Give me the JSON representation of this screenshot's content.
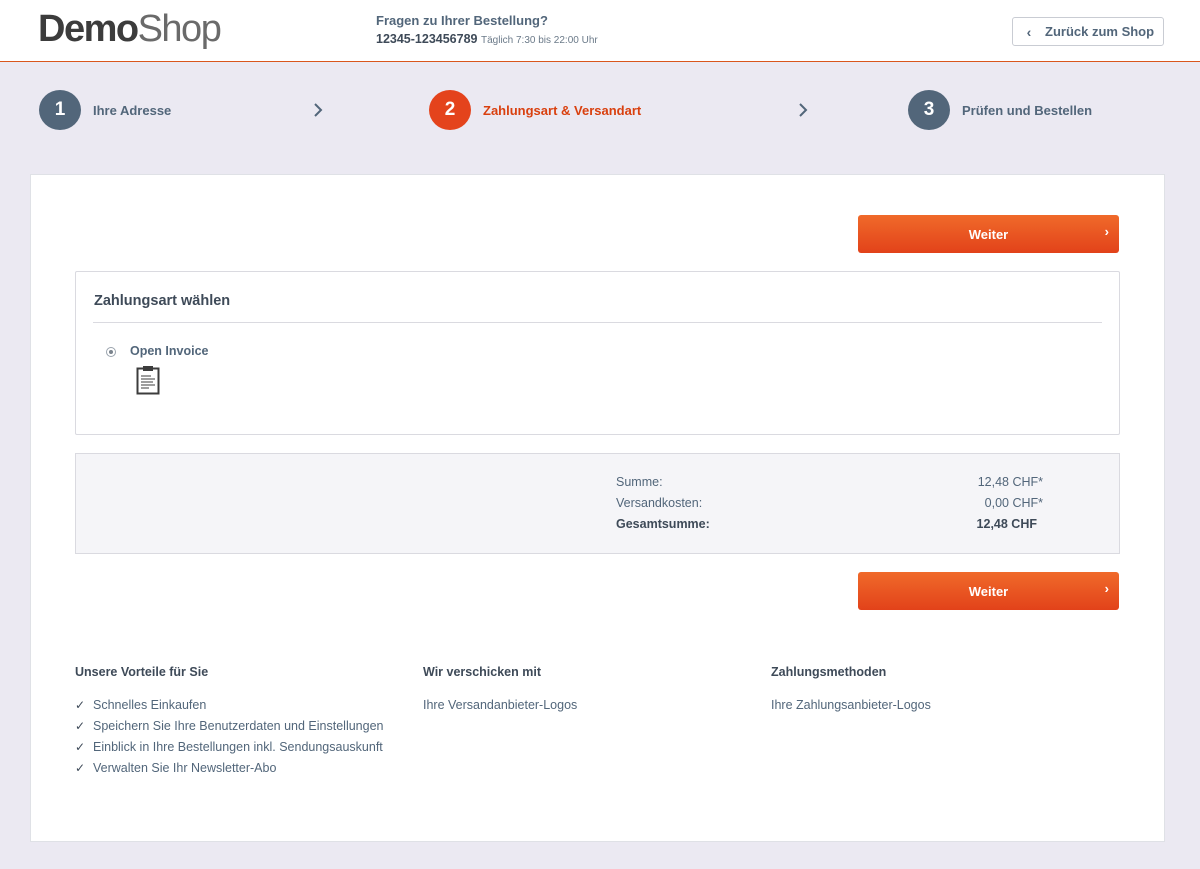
{
  "header": {
    "logo_part1": "Demo",
    "logo_part2": "Shop",
    "hotline_question": "Fragen zu Ihrer Bestellung?",
    "hotline_number": "12345-123456789",
    "hotline_hours": "Täglich 7:30 bis 22:00 Uhr",
    "back_label": "Zurück zum Shop"
  },
  "steps": [
    {
      "number": "1",
      "label": "Ihre Adresse",
      "state": "done"
    },
    {
      "number": "2",
      "label": "Zahlungsart & Versandart",
      "state": "active"
    },
    {
      "number": "3",
      "label": "Prüfen und Bestellen",
      "state": "upcoming"
    }
  ],
  "actions": {
    "next_label": "Weiter"
  },
  "payment": {
    "title": "Zahlungsart wählen",
    "methods": [
      {
        "name": "Open Invoice",
        "selected": true,
        "icon": "clipboard-icon"
      }
    ]
  },
  "summary": {
    "rows": [
      {
        "label": "Summe:",
        "value": "12,48 CHF*"
      },
      {
        "label": "Versandkosten:",
        "value": "0,00 CHF*"
      },
      {
        "label": "Gesamtsumme:",
        "value": "12,48 CHF"
      }
    ]
  },
  "footer": {
    "benefits_title": "Unsere Vorteile für Sie",
    "benefits": [
      "Schnelles Einkaufen",
      "Speichern Sie Ihre Benutzerdaten und Einstellungen",
      "Einblick in Ihre Bestellungen inkl. Sendungsauskunft",
      "Verwalten Sie Ihr Newsletter-Abo"
    ],
    "shipping_title": "Wir verschicken mit",
    "shipping_text": "Ihre Versandanbieter-Logos",
    "payment_title": "Zahlungsmethoden",
    "payment_text": "Ihre Zahlungsanbieter-Logos"
  },
  "colors": {
    "accent": "#e4431c",
    "step_inactive": "#52667a",
    "background": "#ebe9f2"
  }
}
